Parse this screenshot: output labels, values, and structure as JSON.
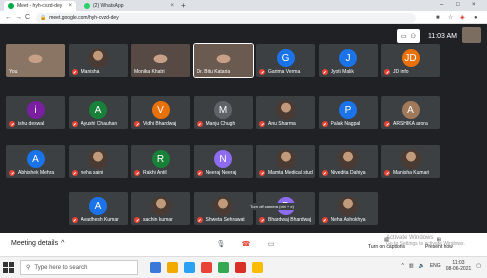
{
  "browser": {
    "tabs": [
      {
        "title": "Meet - hyh-cvzd-dey",
        "favicon_color": "#00ac47",
        "close": "×"
      },
      {
        "title": "(2) WhatsApp",
        "favicon_color": "#25d366",
        "close": "×"
      }
    ],
    "new_tab": "+",
    "nav": {
      "back": "←",
      "forward": "→",
      "reload": "C"
    },
    "url": "meet.google.com/hyh-cvzd-dey",
    "window_controls": {
      "minimize": "–",
      "maximize": "□",
      "close": "×"
    }
  },
  "meet": {
    "present_chip_icons": [
      "present-icon",
      "people-icon"
    ],
    "clock": "11:03 AM",
    "tooltip": "Turn off camera (ctrl + e)",
    "rows": [
      [
        {
          "name": "You",
          "kind": "video",
          "bg": "#8a7565",
          "muted": false
        },
        {
          "name": "Manisha",
          "kind": "photo",
          "muted": true
        },
        {
          "name": "Monika Khatri",
          "kind": "video",
          "bg": "#574a44",
          "muted": false
        },
        {
          "name": "Dr. Bitu Kataria",
          "kind": "video",
          "bg": "#6b5a4f",
          "muted": false,
          "active": true
        },
        {
          "name": "Garima Verma",
          "kind": "letter",
          "letter": "G",
          "color": "#1a73e8",
          "muted": true
        },
        {
          "name": "Jyoti Malik",
          "kind": "letter",
          "letter": "J",
          "color": "#1a73e8",
          "muted": true
        },
        {
          "name": "JD info",
          "kind": "letter",
          "letter": "JD",
          "color": "#e8710a",
          "muted": true
        }
      ],
      [
        {
          "name": "ishu deswal",
          "kind": "letter",
          "letter": "i",
          "color": "#7b1fa2",
          "muted": true
        },
        {
          "name": "Ayushi Chauhan",
          "kind": "letter",
          "letter": "A",
          "color": "#188038",
          "muted": true
        },
        {
          "name": "Vidhi Bhardwaj",
          "kind": "letter",
          "letter": "V",
          "color": "#e8710a",
          "muted": true
        },
        {
          "name": "Manju Chugh",
          "kind": "letter",
          "letter": "M",
          "color": "#5f6368",
          "muted": true
        },
        {
          "name": "Anu Sharma",
          "kind": "photo",
          "muted": true
        },
        {
          "name": "Palak Nagpal",
          "kind": "letter",
          "letter": "P",
          "color": "#1a73e8",
          "muted": true
        },
        {
          "name": "ARSHIKA arora",
          "kind": "letter",
          "letter": "A",
          "color": "#a0785a",
          "muted": true
        }
      ],
      [
        {
          "name": "Abhishek Mehra",
          "kind": "letter",
          "letter": "A",
          "color": "#1a73e8",
          "muted": true
        },
        {
          "name": "neha saini",
          "kind": "photo",
          "muted": true
        },
        {
          "name": "Rakhi Antil",
          "kind": "letter",
          "letter": "R",
          "color": "#188038",
          "muted": true
        },
        {
          "name": "Neeraj Neeraj",
          "kind": "letter",
          "letter": "N",
          "color": "#8e6cef",
          "muted": true
        },
        {
          "name": "Mamta Medical stud...",
          "kind": "photo",
          "muted": true
        },
        {
          "name": "Nivedita Dahiya",
          "kind": "photo",
          "muted": true
        },
        {
          "name": "Manisha Kumari",
          "kind": "photo",
          "muted": true
        }
      ],
      [
        {
          "name": "Avadhesh Kumar",
          "kind": "letter",
          "letter": "A",
          "color": "#1a73e8",
          "muted": true
        },
        {
          "name": "sachin kumar",
          "kind": "photo",
          "muted": true
        },
        {
          "name": "Shweta Sehrawat",
          "kind": "photo",
          "muted": true
        },
        {
          "name": "Bhardwaj Bhardwaj",
          "kind": "letter",
          "letter": "B",
          "color": "#8e6cef",
          "muted": true
        },
        {
          "name": "Neha Ashokhya",
          "kind": "photo",
          "muted": true
        }
      ]
    ],
    "bottom": {
      "meeting_details": "Meeting details",
      "chevron": "^",
      "captions": "Turn on captions",
      "present": "Present now",
      "watermark_line1": "Activate Windows",
      "watermark_line2": "Go to Settings to activate Windows."
    }
  },
  "taskbar": {
    "search_placeholder": "Type here to search",
    "apps": [
      "#3c78d8",
      "#f2a900",
      "#2aa1f3",
      "#ea4335",
      "#34a853",
      "#d93025",
      "#fbbc05"
    ],
    "lang": "ENG",
    "time": "11:03",
    "date": "08-06-2021"
  }
}
